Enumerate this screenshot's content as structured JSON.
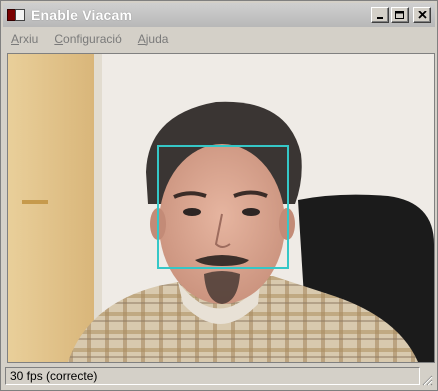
{
  "window": {
    "title": "Enable Viacam"
  },
  "menu": {
    "items": [
      {
        "label": "Arxiu",
        "accel": "A",
        "rest": "rxiu"
      },
      {
        "label": "Configuració",
        "accel": "C",
        "rest": "onfiguració"
      },
      {
        "label": "Ajuda",
        "accel": "A",
        "rest": "juda"
      }
    ]
  },
  "status": {
    "text": "30 fps (correcte)"
  },
  "icons": {
    "minimize": "minimize-icon",
    "maximize": "maximize-icon",
    "close": "close-icon"
  },
  "colors": {
    "tracking_box": "#35c7c7"
  }
}
